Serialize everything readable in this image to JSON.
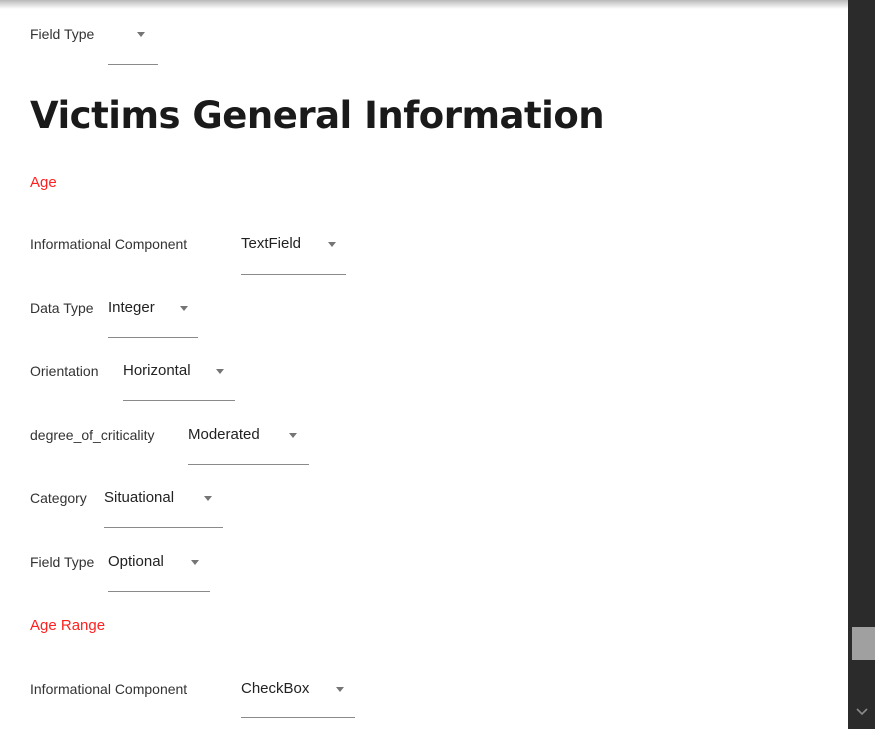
{
  "top_field": {
    "label": "Field Type",
    "value": ""
  },
  "section": {
    "title": "Victims General Information"
  },
  "fields": [
    {
      "name": "Age",
      "properties": [
        {
          "label": "Informational Component",
          "value": "TextField"
        },
        {
          "label": "Data Type",
          "value": "Integer"
        },
        {
          "label": "Orientation",
          "value": "Horizontal"
        },
        {
          "label": "degree_of_criticality",
          "value": "Moderated"
        },
        {
          "label": "Category",
          "value": "Situational"
        },
        {
          "label": "Field Type",
          "value": "Optional"
        }
      ]
    },
    {
      "name": "Age Range",
      "properties": [
        {
          "label": "Informational Component",
          "value": "CheckBox"
        }
      ]
    }
  ],
  "scrollbar": {
    "arrow_icon": "chevron-down-icon"
  }
}
